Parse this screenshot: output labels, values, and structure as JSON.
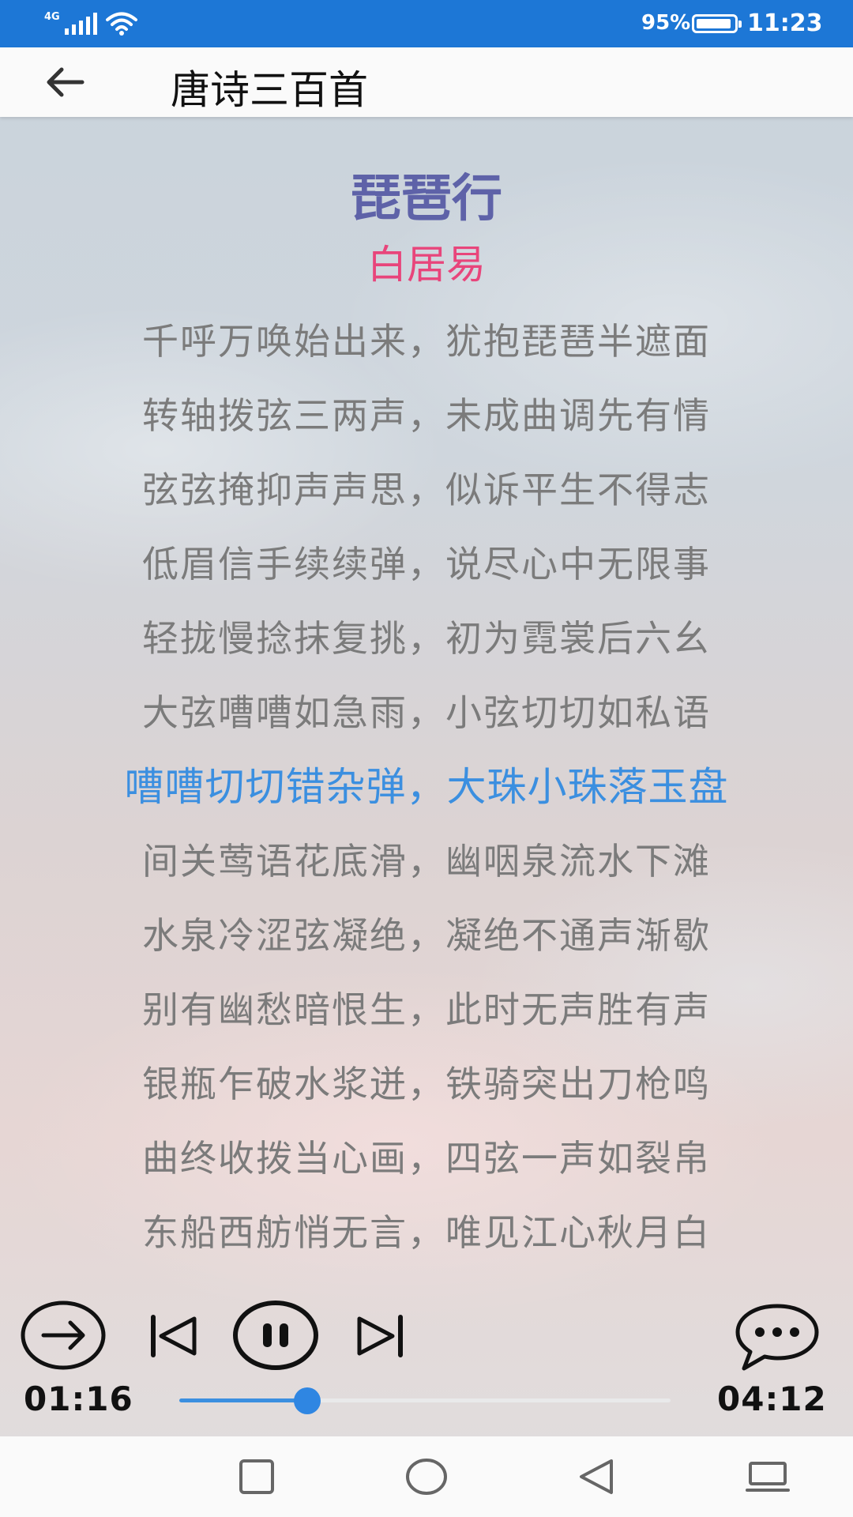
{
  "status": {
    "network": "4G",
    "battery_pct": "95%",
    "battery_level": 0.95,
    "time": "11:23"
  },
  "appbar": {
    "title": "唐诗三百首"
  },
  "poem": {
    "title": "琵琶行",
    "author": "白居易",
    "lines": [
      "千呼万唤始出来，犹抱琵琶半遮面",
      "转轴拨弦三两声，未成曲调先有情",
      "弦弦掩抑声声思，似诉平生不得志",
      "低眉信手续续弹，说尽心中无限事",
      "轻拢慢捻抹复挑，初为霓裳后六幺",
      "大弦嘈嘈如急雨，小弦切切如私语",
      "嘈嘈切切错杂弹，大珠小珠落玉盘",
      "间关莺语花底滑，幽咽泉流水下滩",
      "水泉冷涩弦凝绝，凝绝不通声渐歇",
      "别有幽愁暗恨生，此时无声胜有声",
      "银瓶乍破水浆迸，铁骑突出刀枪鸣",
      "曲终收拨当心画，四弦一声如裂帛",
      "东船西舫悄无言，唯见江心秋月白"
    ],
    "active_line_index": 6
  },
  "player": {
    "current_time": "01:16",
    "total_time": "04:12",
    "progress": 0.26
  },
  "icons": {
    "back": "arrow-left-icon",
    "next_poem": "circle-arrow-right-icon",
    "previous": "skip-previous-icon",
    "pause": "pause-circle-icon",
    "next": "skip-next-icon",
    "comment": "chat-bubble-icon",
    "nav_recent": "square-icon",
    "nav_home": "circle-icon",
    "nav_back": "triangle-back-icon",
    "nav_keyboard": "keyboard-icon"
  },
  "colors": {
    "status_bar": "#1d77d6",
    "title": "#5e62a8",
    "author": "#e8457b",
    "line_text": "#7b7b7b",
    "active_line": "#3b8fe0"
  }
}
